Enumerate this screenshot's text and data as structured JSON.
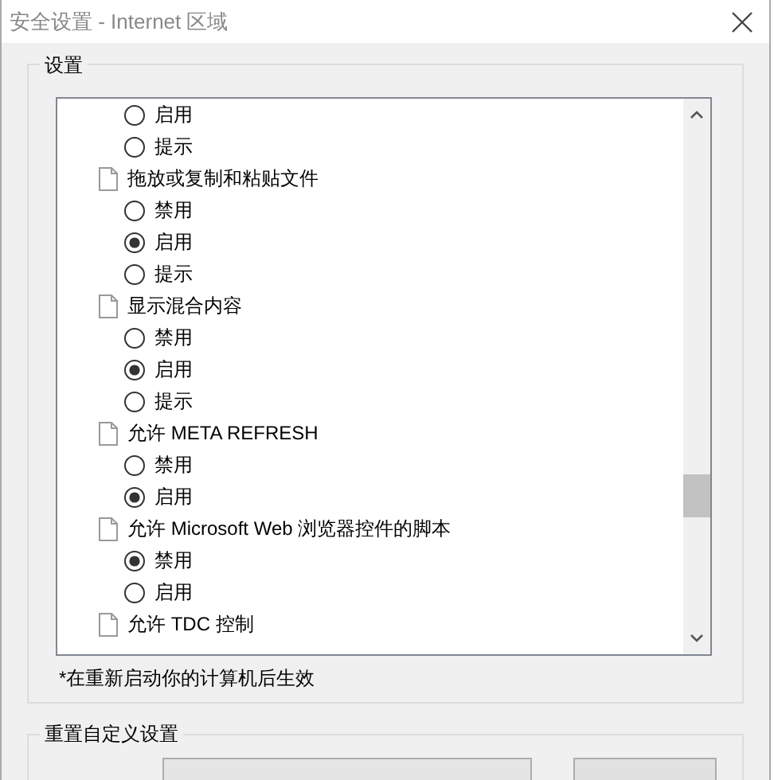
{
  "window": {
    "title": "安全设置 - Internet 区域"
  },
  "settings": {
    "label": "设置",
    "groups": [
      {
        "options": [
          {
            "label": "启用",
            "selected": false
          },
          {
            "label": "提示",
            "selected": false
          }
        ]
      },
      {
        "title": "拖放或复制和粘贴文件",
        "options": [
          {
            "label": "禁用",
            "selected": false
          },
          {
            "label": "启用",
            "selected": true
          },
          {
            "label": "提示",
            "selected": false
          }
        ]
      },
      {
        "title": "显示混合内容",
        "options": [
          {
            "label": "禁用",
            "selected": false
          },
          {
            "label": "启用",
            "selected": true
          },
          {
            "label": "提示",
            "selected": false
          }
        ]
      },
      {
        "title": "允许 META REFRESH",
        "options": [
          {
            "label": "禁用",
            "selected": false
          },
          {
            "label": "启用",
            "selected": true
          }
        ]
      },
      {
        "title": "允许 Microsoft Web 浏览器控件的脚本",
        "options": [
          {
            "label": "禁用",
            "selected": true
          },
          {
            "label": "启用",
            "selected": false
          }
        ]
      },
      {
        "title": "允许 TDC 控制"
      }
    ],
    "note": "*在重新启动你的计算机后生效"
  },
  "reset": {
    "label": "重置自定义设置"
  }
}
